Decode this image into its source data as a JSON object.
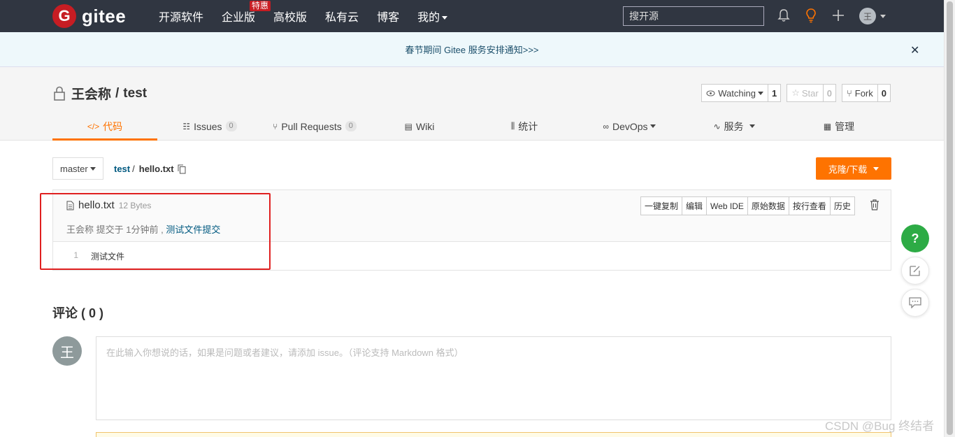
{
  "topnav": {
    "logo_letter": "G",
    "logo_text": "gitee",
    "links": [
      "开源软件",
      "企业版",
      "高校版",
      "私有云",
      "博客",
      "我的"
    ],
    "enterprise_badge": "特惠",
    "search_placeholder": "搜开源",
    "avatar_letter": "王"
  },
  "notice": {
    "text": "春节期间 Gitee 服务安排通知>>>",
    "close": "✕"
  },
  "repo": {
    "owner": "王会称",
    "separator": "/",
    "name": "test",
    "watch_label": "Watching",
    "watch_count": "1",
    "star_label": "Star",
    "star_count": "0",
    "fork_label": "Fork",
    "fork_count": "0"
  },
  "tabs": [
    {
      "icon": "</>",
      "label": "代码"
    },
    {
      "icon": "☷",
      "label": "Issues",
      "count": "0"
    },
    {
      "icon": "⑂",
      "label": "Pull Requests",
      "count": "0"
    },
    {
      "icon": "▤",
      "label": "Wiki"
    },
    {
      "icon": "⫼",
      "label": "统计"
    },
    {
      "icon": "∞",
      "label": "DevOps"
    },
    {
      "icon": "∿",
      "label": "服务"
    },
    {
      "icon": "▦",
      "label": "管理"
    }
  ],
  "branch": {
    "name": "master",
    "crumb_repo": "test",
    "crumb_sep": "/",
    "crumb_file": "hello.txt",
    "clone_label": "克隆/下载"
  },
  "file": {
    "name": "hello.txt",
    "size": "12 Bytes",
    "commit_author_time": "王会称 提交于 1分钟前 ,",
    "commit_message": "测试文件提交",
    "tools": [
      "一键复制",
      "编辑",
      "Web IDE",
      "原始数据",
      "按行查看",
      "历史"
    ],
    "lines": [
      {
        "no": "1",
        "text": "测试文件"
      }
    ]
  },
  "comments": {
    "title": "评论 ( 0 )",
    "avatar_letter": "王",
    "placeholder": "在此输入你想说的话，如果是问题或者建议，请添加 issue。（评论支持 Markdown 格式）"
  },
  "float": {
    "help": "?"
  },
  "watermark": "CSDN @Bug 终结者",
  "colors": {
    "nav_bg": "#303641",
    "brand_red": "#c71d23",
    "accent_orange": "#fe7300",
    "link_blue": "#005980",
    "help_green": "#2dab45",
    "highlight_red": "#e02020"
  }
}
